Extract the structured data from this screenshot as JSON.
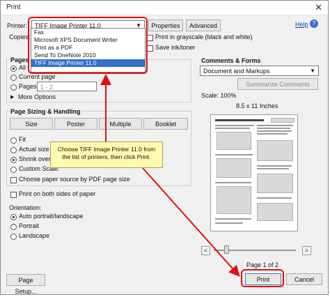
{
  "window": {
    "title": "Print",
    "close_glyph": "✕"
  },
  "printer": {
    "label": "Printer:",
    "selected": "TIFF Image Printer 11.0",
    "properties_label": "Properties",
    "advanced_label": "Advanced",
    "help_label": "Help",
    "options": [
      "Fax",
      "Microsoft XPS Document Writer",
      "Print as a PDF",
      "Send To OneNote 2010",
      "TIFF Image Printer 11.0"
    ]
  },
  "copies": {
    "label": "Copies:"
  },
  "print_grayscale_label": "Print in grayscale (black and white)",
  "save_ink_label": "Save ink/toner",
  "pages_to_print": {
    "title": "Pages to",
    "all": "All",
    "current": "Current page",
    "pages": "Pages",
    "pages_value": "1 - 2",
    "more_options": "More Options"
  },
  "sizing": {
    "title": "Page Sizing & Handling",
    "tabs": [
      "Size",
      "Poster",
      "Multiple",
      "Booklet"
    ],
    "fit": "Fit",
    "actual_size": "Actual size",
    "shrink": "Shrink oversized",
    "custom_scale": "Custom Scale:",
    "paper_source": "Choose paper source by PDF page size"
  },
  "both_sides": "Print on both sides of paper",
  "orientation": {
    "title": "Orientation:",
    "auto": "Auto portrait/landscape",
    "portrait": "Portrait",
    "landscape": "Landscape"
  },
  "comments": {
    "title": "Comments & Forms",
    "selected": "Document and Markups",
    "summarize_label": "Summarize Comments"
  },
  "preview": {
    "scale": "Scale: 100%",
    "paper": "8.5 x 11 Inches",
    "page_indicator": "Page 1 of 2"
  },
  "callout_text": "Choose TIFF Image Printer 11.0 from the list of printers, then click Print.",
  "buttons": {
    "page_setup": "Page Setup...",
    "print": "Print",
    "cancel": "Cancel"
  },
  "colors": {
    "highlight": "#3370cc",
    "annotation_red": "#e01010",
    "callout_bg": "#fff9b0"
  }
}
